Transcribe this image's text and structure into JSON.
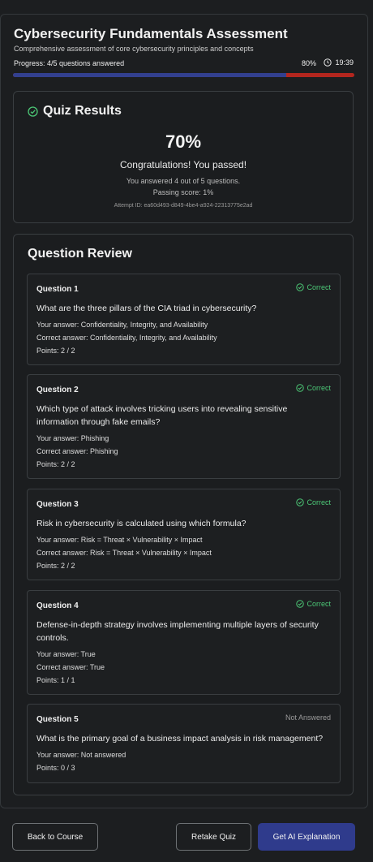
{
  "header": {
    "title": "Cybersecurity Fundamentals Assessment",
    "subtitle": "Comprehensive assessment of core cybersecurity principles and concepts",
    "progress_label": "Progress: 4/5 questions answered",
    "progress_percent_label": "80%",
    "progress_value": 80,
    "timer": "19:39"
  },
  "results": {
    "title": "Quiz Results",
    "score": "70%",
    "message": "Congratulations! You passed!",
    "answered": "You answered 4 out of 5 questions.",
    "passing": "Passing score: 1%",
    "attempt": "Attempt ID: ea60d493-d849-4be4-a924-22313775e2ad"
  },
  "review": {
    "title": "Question Review",
    "questions": [
      {
        "number": "Question 1",
        "status": "Correct",
        "text": "What are the three pillars of the CIA triad in cybersecurity?",
        "your_answer": "Your answer: Confidentiality, Integrity, and Availability",
        "correct_answer": "Correct answer: Confidentiality, Integrity, and Availability",
        "points": "Points: 2 / 2"
      },
      {
        "number": "Question 2",
        "status": "Correct",
        "text": "Which type of attack involves tricking users into revealing sensitive information through fake emails?",
        "your_answer": "Your answer: Phishing",
        "correct_answer": "Correct answer: Phishing",
        "points": "Points: 2 / 2"
      },
      {
        "number": "Question 3",
        "status": "Correct",
        "text": "Risk in cybersecurity is calculated using which formula?",
        "your_answer": "Your answer: Risk = Threat × Vulnerability × Impact",
        "correct_answer": "Correct answer: Risk = Threat × Vulnerability × Impact",
        "points": "Points: 2 / 2"
      },
      {
        "number": "Question 4",
        "status": "Correct",
        "text": "Defense-in-depth strategy involves implementing multiple layers of security controls.",
        "your_answer": "Your answer: True",
        "correct_answer": "Correct answer: True",
        "points": "Points: 1 / 1"
      },
      {
        "number": "Question 5",
        "status": "Not Answered",
        "text": "What is the primary goal of a business impact analysis in risk management?",
        "your_answer": "Your answer: Not answered",
        "points": "Points: 0 / 3"
      }
    ]
  },
  "actions": {
    "back": "Back to Course",
    "retake": "Retake Quiz",
    "ai": "Get AI Explanation"
  },
  "colors": {
    "accent": "#2f3b8c",
    "correct": "#4cc776",
    "progress_remaining": "#b3261e"
  },
  "icons": {
    "results": "check-circle-icon",
    "timer": "clock-icon",
    "correct": "check-circle-icon"
  }
}
